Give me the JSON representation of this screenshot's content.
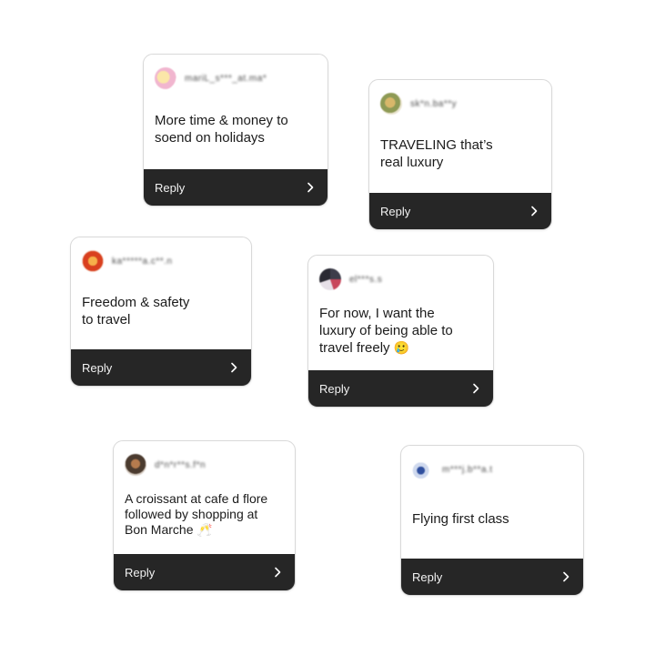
{
  "comments": [
    {
      "username": "mariL_s***_at.ma*",
      "message": "More time & money to\nsoend on holidays",
      "emoji": "",
      "reply_label": "Reply",
      "avatar_colors": [
        "#f3c6d8",
        "#f7e39a"
      ]
    },
    {
      "username": "sk*n.ba**y",
      "message": "TRAVELING that’s\nreal luxury",
      "emoji": "",
      "reply_label": "Reply",
      "avatar_colors": [
        "#c7a35c",
        "#7b8f4a"
      ]
    },
    {
      "username": "ka*****a.c**.n",
      "message": "Freedom & safety\nto travel",
      "emoji": "",
      "reply_label": "Reply",
      "avatar_colors": [
        "#e2572d",
        "#f2a23a"
      ]
    },
    {
      "username": "el***s.s",
      "message": "For now, I want the\nluxury of being able to\ntravel freely",
      "emoji": "🥲",
      "reply_label": "Reply",
      "avatar_colors": [
        "#3d3d4a",
        "#c8475c"
      ]
    },
    {
      "username": "d*n*r**s.f*n",
      "message": "A croissant at cafe d flore\nfollowed by shopping at\nBon Marche",
      "emoji": "🥂",
      "reply_label": "Reply",
      "avatar_colors": [
        "#4b3b2f",
        "#b57b4e"
      ]
    },
    {
      "username": "m***j.b**a.t",
      "message": "Flying first class",
      "emoji": "",
      "reply_label": "Reply",
      "avatar_colors": [
        "#2f4f9e",
        "#cfd9ee"
      ]
    }
  ],
  "colors": {
    "reply_bar": "#262626",
    "card_border": "#d9d9d9",
    "text": "#1b1b1b"
  },
  "icons": {
    "reply_chevron": "chevron-right-icon"
  }
}
